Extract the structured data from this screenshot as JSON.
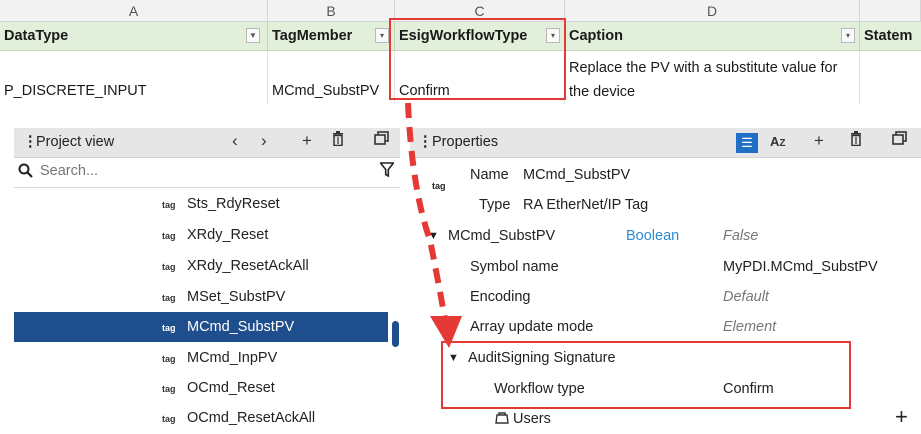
{
  "sheet": {
    "columns": [
      "A",
      "B",
      "C",
      "D"
    ],
    "headers": [
      "DataType",
      "TagMember",
      "EsigWorkflowType",
      "Caption",
      "Statem"
    ],
    "row": {
      "datatype": "P_DISCRETE_INPUT",
      "tagmember": "MCmd_SubstPV",
      "esig": "Confirm",
      "caption": "Replace the PV with a substitute value for the device"
    }
  },
  "project_view": {
    "title": "Project view",
    "search_placeholder": "Search...",
    "tag_glyph": "tag",
    "items": [
      "Sts_RdyReset",
      "XRdy_Reset",
      "XRdy_ResetAckAll",
      "MSet_SubstPV",
      "MCmd_SubstPV",
      "MCmd_InpPV",
      "OCmd_Reset",
      "OCmd_ResetAckAll"
    ],
    "selected_index": 4
  },
  "properties": {
    "title": "Properties",
    "name_label": "Name",
    "name_value": "MCmd_SubstPV",
    "type_label": "Type",
    "type_value": "RA EtherNet/IP Tag",
    "member": {
      "name": "MCmd_SubstPV",
      "datatype": "Boolean",
      "value": "False"
    },
    "rows": [
      {
        "label": "Symbol name",
        "value": "MyPDI.MCmd_SubstPV"
      },
      {
        "label": "Encoding",
        "value": "Default"
      },
      {
        "label": "Array update mode",
        "value": "Element"
      }
    ],
    "group": "AuditSigning Signature",
    "workflow_label": "Workflow type",
    "workflow_value": "Confirm",
    "users_label": "Users"
  },
  "colors": {
    "highlight": "#e53935",
    "selected": "#1f4e8c",
    "header_green": "#e2efda",
    "accent_blue": "#1f6fc5"
  },
  "icons": [
    "chevron-left-icon",
    "chevron-right-icon",
    "plus-icon",
    "trash-icon",
    "detach-icon",
    "search-icon",
    "filter-icon",
    "sort-icon",
    "alpha-sort-icon",
    "caret-down-icon",
    "users-icon"
  ]
}
